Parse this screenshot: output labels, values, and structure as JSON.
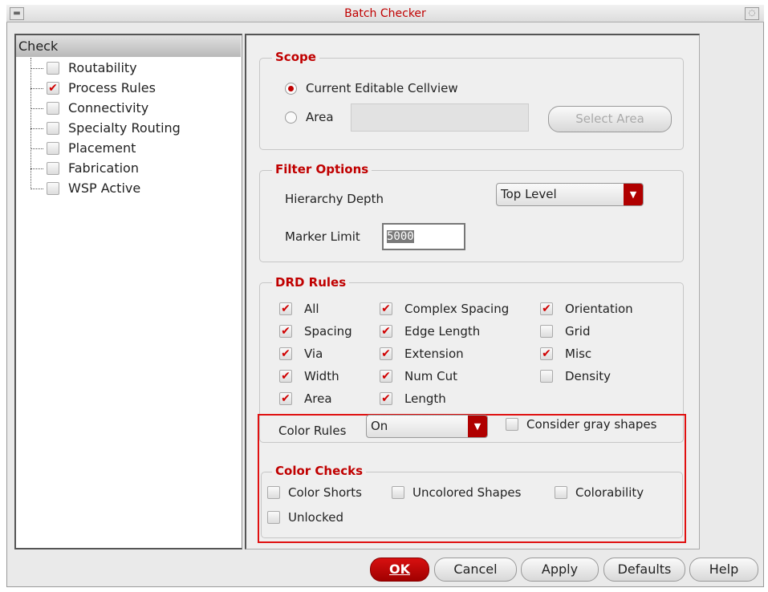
{
  "window": {
    "title": "Batch Checker"
  },
  "tree": {
    "header": "Check",
    "items": [
      {
        "label": "Routability",
        "checked": false
      },
      {
        "label": "Process Rules",
        "checked": true
      },
      {
        "label": "Connectivity",
        "checked": false
      },
      {
        "label": "Specialty Routing",
        "checked": false
      },
      {
        "label": "Placement",
        "checked": false
      },
      {
        "label": "Fabrication",
        "checked": false
      },
      {
        "label": "WSP Active",
        "checked": false
      }
    ]
  },
  "scope": {
    "title": "Scope",
    "current": "Current Editable Cellview",
    "area": "Area",
    "area_value": "",
    "select_area": "Select Area",
    "selected": "current"
  },
  "filter": {
    "title": "Filter Options",
    "depth_label": "Hierarchy Depth",
    "depth_value": "Top Level",
    "marker_label": "Marker Limit",
    "marker_value": "5000"
  },
  "drd": {
    "title": "DRD Rules",
    "rules": [
      {
        "label": "All",
        "checked": true
      },
      {
        "label": "Complex Spacing",
        "checked": true
      },
      {
        "label": "Orientation",
        "checked": true
      },
      {
        "label": "Spacing",
        "checked": true
      },
      {
        "label": "Edge Length",
        "checked": true
      },
      {
        "label": "Grid",
        "checked": false
      },
      {
        "label": "Via",
        "checked": true
      },
      {
        "label": "Extension",
        "checked": true
      },
      {
        "label": "Misc",
        "checked": true
      },
      {
        "label": "Width",
        "checked": true
      },
      {
        "label": "Num Cut",
        "checked": true
      },
      {
        "label": "Density",
        "checked": false
      },
      {
        "label": "Area",
        "checked": true
      },
      {
        "label": "Length",
        "checked": true
      }
    ],
    "color_rules_label": "Color Rules",
    "color_rules_value": "On",
    "consider_gray": "Consider gray shapes"
  },
  "color_checks": {
    "title": "Color Checks",
    "items": [
      {
        "label": "Color Shorts",
        "checked": false
      },
      {
        "label": "Uncolored Shapes",
        "checked": false
      },
      {
        "label": "Colorability",
        "checked": false
      },
      {
        "label": "Unlocked",
        "checked": false
      }
    ]
  },
  "buttons": {
    "ok": "OK",
    "cancel": "Cancel",
    "apply": "Apply",
    "defaults": "Defaults",
    "help": "Help"
  },
  "colors": {
    "accent": "#c00000"
  }
}
